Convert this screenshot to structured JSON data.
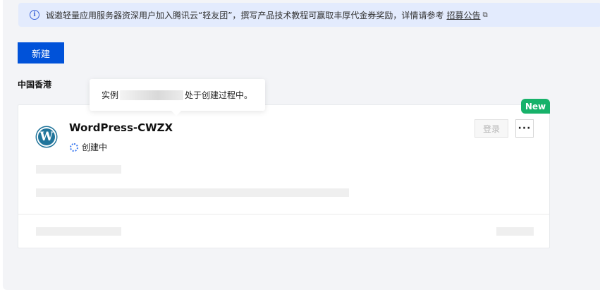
{
  "notice": {
    "text": "诚邀轻量应用服务器资深用户加入腾讯云“轻友团”，撰写产品技术教程可赢取丰厚代金券奖励，详情请参考",
    "link": "招募公告",
    "icon": "info-icon"
  },
  "toolbar": {
    "new_label": "新建"
  },
  "region": {
    "label": "中国香港"
  },
  "tooltip": {
    "prefix": "实例",
    "suffix": "处于创建过程中。"
  },
  "instance": {
    "badge": "New",
    "name": "WordPress-CWZX",
    "logo_letter": "W",
    "status": "创建中",
    "login_label": "登录",
    "more_label": "···"
  },
  "colors": {
    "primary": "#0052d9",
    "badge": "#17b26a",
    "notice_bg": "#e3ebfd",
    "wordpress": "#21759b"
  }
}
